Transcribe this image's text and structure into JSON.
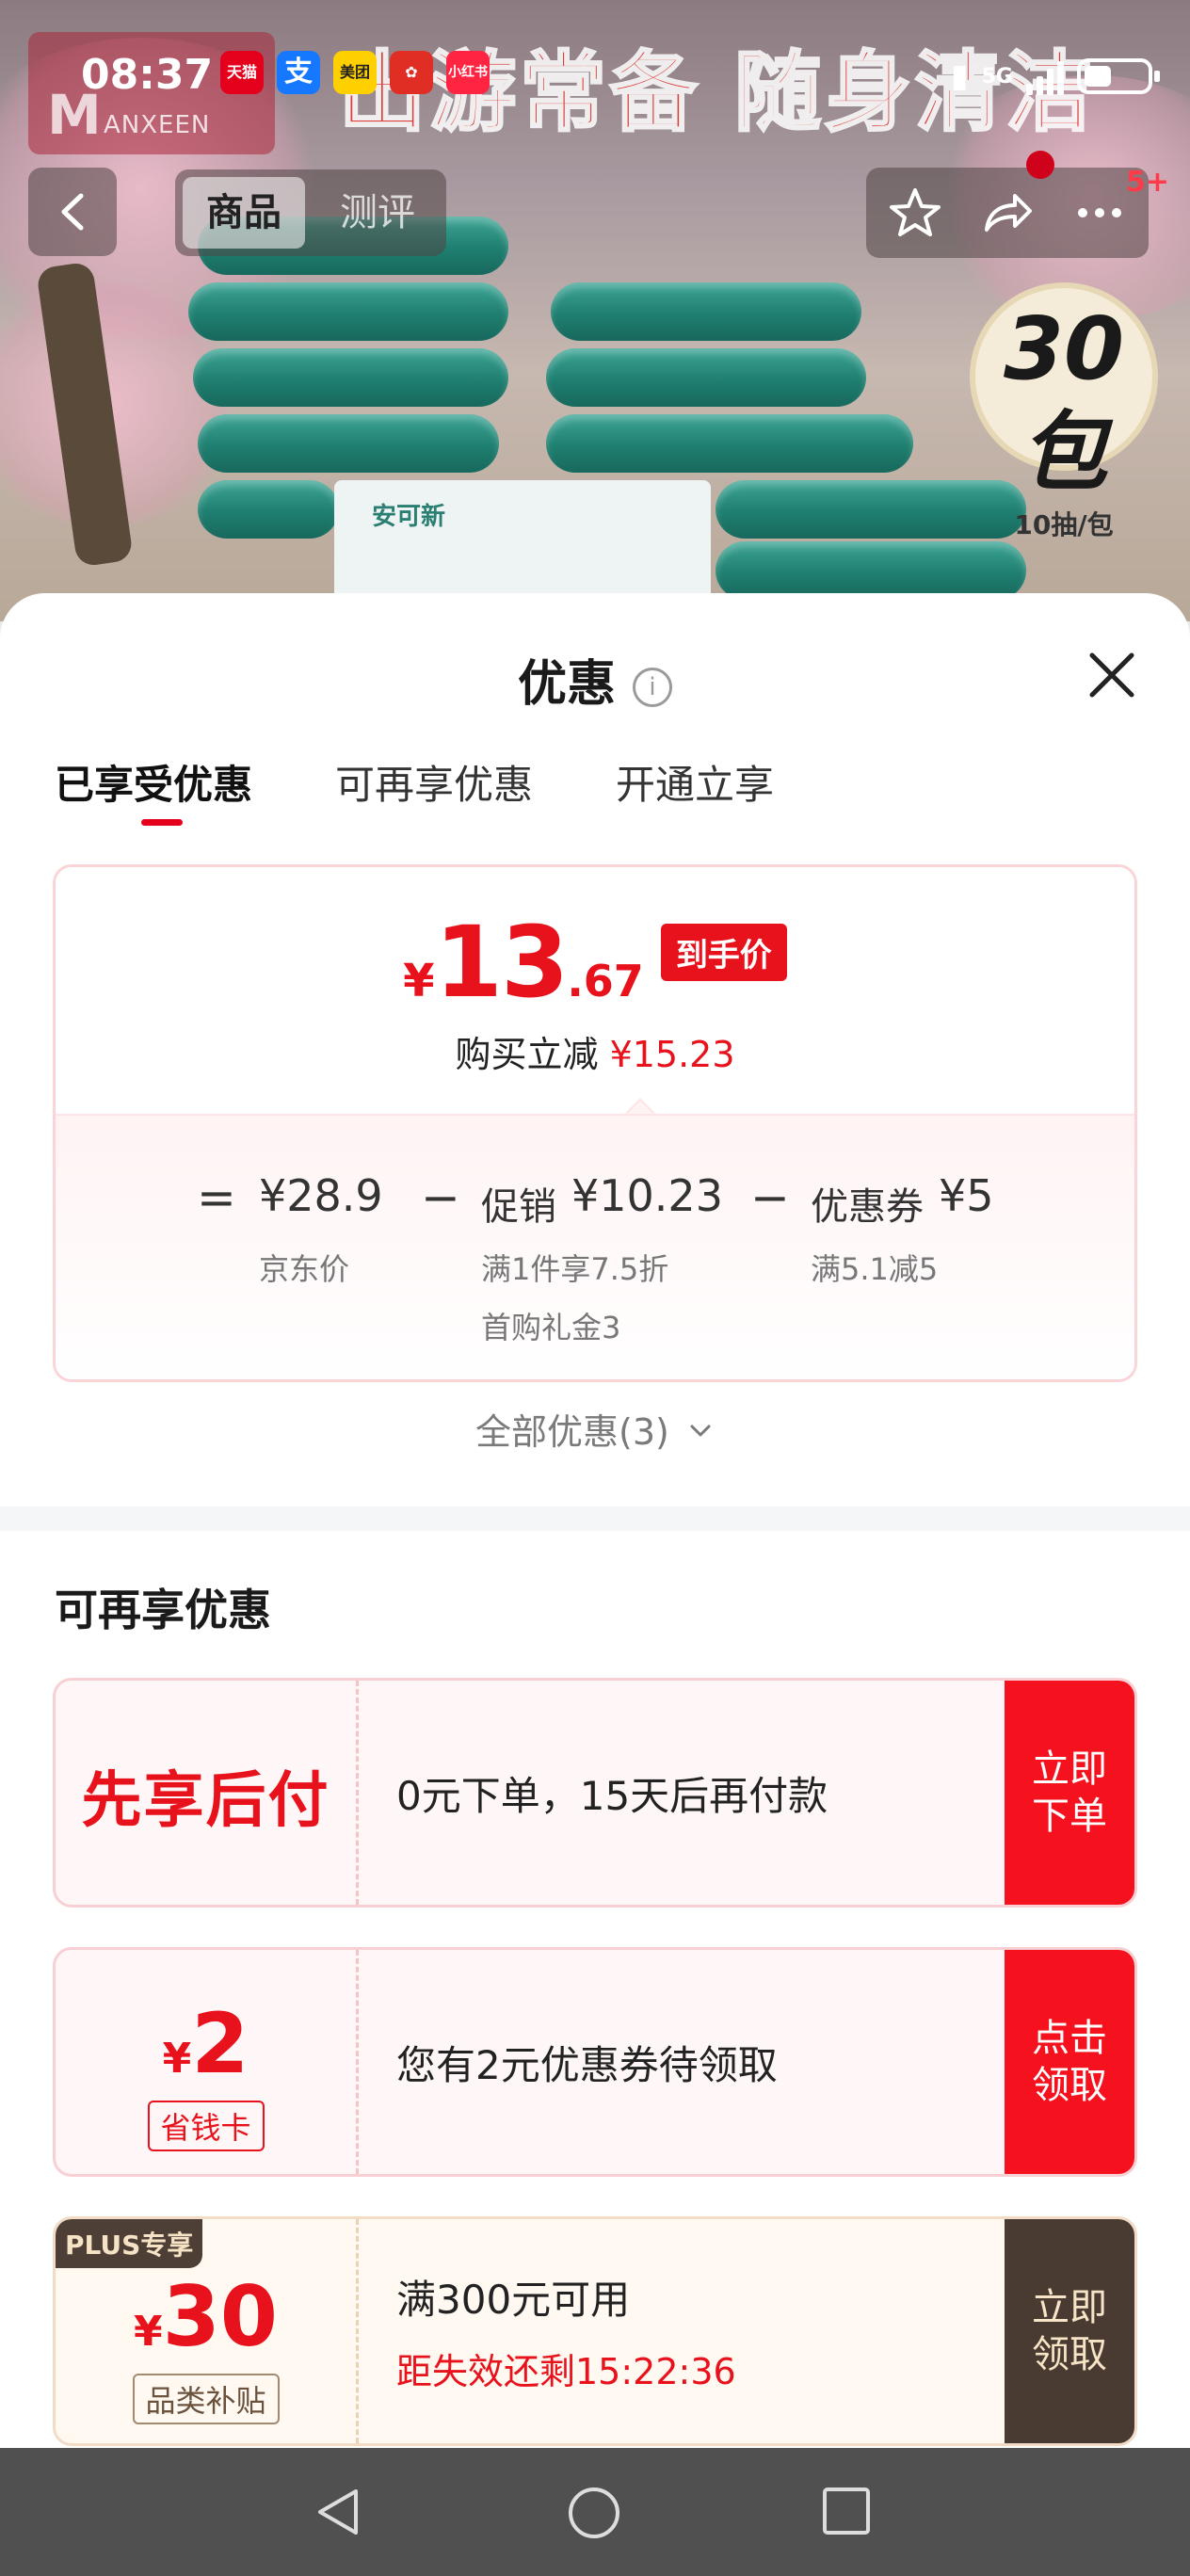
{
  "status_bar": {
    "time": "08:37",
    "apps": [
      {
        "name": "tmall-app-icon",
        "label": "天猫",
        "color": "#e4001c"
      },
      {
        "name": "alipay-app-icon",
        "label": "支",
        "color": "#1677ff"
      },
      {
        "name": "meituan-app-icon",
        "label": "美团",
        "color": "#ffd000"
      },
      {
        "name": "pinduoduo-app-icon",
        "label": "",
        "color": "#e02e24"
      },
      {
        "name": "xiaohongshu-app-icon",
        "label": "小红书",
        "color": "#ff2442"
      }
    ],
    "network": "5G"
  },
  "banner": {
    "promo_title": "出游常备 随身清洁",
    "badge_number": "30包",
    "badge_sub": "10抽/包",
    "logo_text": "ANXEEN",
    "logo_cn": "安可新",
    "tabs": [
      "商品",
      "测评"
    ],
    "message_count": "5+"
  },
  "sheet": {
    "title": "优惠",
    "info_icon": "i",
    "tabs": [
      "已享受优惠",
      "可再享优惠",
      "开通立享"
    ],
    "price": {
      "currency": "¥",
      "integer": "13",
      "decimal": ".67",
      "tag": "到手价",
      "reduce_label": "购买立减",
      "reduce_amount": "¥15.23"
    },
    "breakdown": {
      "eq": "=",
      "jd_price": "¥28.9",
      "jd_label": "京东价",
      "minus1": "−",
      "promo_label": "促销",
      "promo_amount": "¥10.23",
      "promo_note": "满1件享7.5折",
      "promo_note2": "首购礼金3",
      "minus2": "−",
      "coupon_label": "优惠券",
      "coupon_amount": "¥5",
      "coupon_note": "满5.1减5"
    },
    "all_offers": "全部优惠(3)",
    "section_title": "可再享优惠",
    "coupons": [
      {
        "left": "先享后付",
        "text": "0元下单，15天后再付款",
        "button": "立即下单"
      },
      {
        "currency": "¥",
        "amount": "2",
        "pill": "省钱卡",
        "text": "您有2元优惠券待领取",
        "button": "点击领取"
      },
      {
        "tag": "PLUS专享",
        "currency": "¥",
        "amount": "30",
        "pill": "品类补贴",
        "text": "满300元可用",
        "countdown": "距失效还剩15:22:36",
        "button": "立即领取"
      }
    ]
  }
}
